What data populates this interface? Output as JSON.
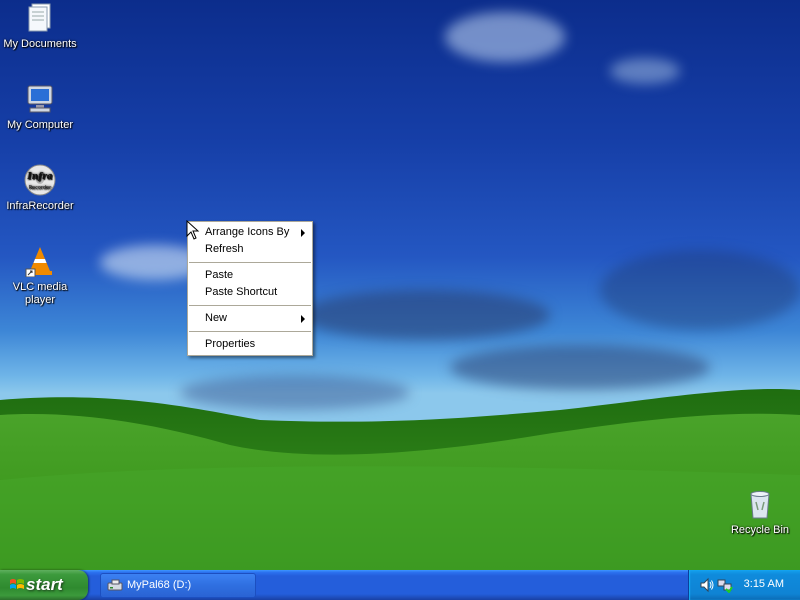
{
  "desktop": {
    "icons": [
      {
        "label": "My Documents",
        "icon": "my-documents-icon"
      },
      {
        "label": "My Computer",
        "icon": "my-computer-icon"
      },
      {
        "label": "InfraRecorder",
        "icon": "infrarecorder-icon",
        "icon_text_top": "Infra",
        "icon_text_bottom": "Recorder"
      },
      {
        "label": "VLC media player",
        "icon": "vlc-icon"
      },
      {
        "label": "Recycle Bin",
        "icon": "recycle-bin-icon"
      }
    ]
  },
  "context_menu": {
    "items": [
      {
        "label": "Arrange Icons By",
        "submenu": true
      },
      {
        "label": "Refresh",
        "submenu": false
      },
      {
        "label": "Paste",
        "submenu": false
      },
      {
        "label": "Paste Shortcut",
        "submenu": false
      },
      {
        "label": "New",
        "submenu": true
      },
      {
        "label": "Properties",
        "submenu": false
      }
    ]
  },
  "taskbar": {
    "start_label": "start",
    "task_buttons": [
      {
        "label": "MyPal68 (D:)",
        "icon": "drive-icon"
      }
    ],
    "tray": {
      "icons": [
        "volume-icon",
        "network-icon"
      ],
      "clock": "3:15 AM"
    }
  },
  "colors": {
    "taskbar_blue": "#245edb",
    "start_green": "#3c9a3c",
    "tray_blue": "#0f83d4"
  }
}
